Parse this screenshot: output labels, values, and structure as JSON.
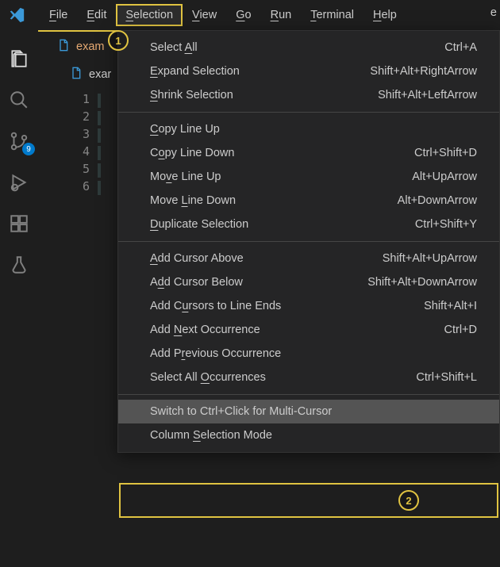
{
  "menubar": {
    "items": [
      {
        "label": "File",
        "mn": 0
      },
      {
        "label": "Edit",
        "mn": 0
      },
      {
        "label": "Selection",
        "mn": 0
      },
      {
        "label": "View",
        "mn": 0
      },
      {
        "label": "Go",
        "mn": 0
      },
      {
        "label": "Run",
        "mn": 0
      },
      {
        "label": "Terminal",
        "mn": 0
      },
      {
        "label": "Help",
        "mn": 0
      }
    ],
    "truncated": "e"
  },
  "tab": {
    "label": "exam",
    "icon": "file-icon"
  },
  "breadcrumb": {
    "label": "exar"
  },
  "line_numbers": [
    "1",
    "2",
    "3",
    "4",
    "5",
    "6"
  ],
  "scm_badge_count": "9",
  "dropdown": {
    "groups": [
      [
        {
          "label": "Select All",
          "mn": 7,
          "shortcut": "Ctrl+A"
        },
        {
          "label": "Expand Selection",
          "mn": 0,
          "shortcut": "Shift+Alt+RightArrow"
        },
        {
          "label": "Shrink Selection",
          "mn": 0,
          "shortcut": "Shift+Alt+LeftArrow"
        }
      ],
      [
        {
          "label": "Copy Line Up",
          "mn": 0,
          "shortcut": ""
        },
        {
          "label": "Copy Line Down",
          "mn": 1,
          "shortcut": "Ctrl+Shift+D"
        },
        {
          "label": "Move Line Up",
          "mn": 2,
          "shortcut": "Alt+UpArrow"
        },
        {
          "label": "Move Line Down",
          "mn": 5,
          "shortcut": "Alt+DownArrow"
        },
        {
          "label": "Duplicate Selection",
          "mn": 0,
          "shortcut": "Ctrl+Shift+Y"
        }
      ],
      [
        {
          "label": "Add Cursor Above",
          "mn": 0,
          "shortcut": "Shift+Alt+UpArrow"
        },
        {
          "label": "Add Cursor Below",
          "mn": 1,
          "shortcut": "Shift+Alt+DownArrow"
        },
        {
          "label": "Add Cursors to Line Ends",
          "mn": 5,
          "shortcut": "Shift+Alt+I"
        },
        {
          "label": "Add Next Occurrence",
          "mn": 4,
          "shortcut": "Ctrl+D"
        },
        {
          "label": "Add Previous Occurrence",
          "mn": 5,
          "shortcut": ""
        },
        {
          "label": "Select All Occurrences",
          "mn": 11,
          "shortcut": "Ctrl+Shift+L"
        }
      ],
      [
        {
          "label": "Switch to Ctrl+Click for Multi-Cursor",
          "mn": -1,
          "shortcut": "",
          "highlight": true
        },
        {
          "label": "Column Selection Mode",
          "mn": 7,
          "shortcut": ""
        }
      ]
    ]
  },
  "callouts": {
    "1": "1",
    "2": "2"
  }
}
